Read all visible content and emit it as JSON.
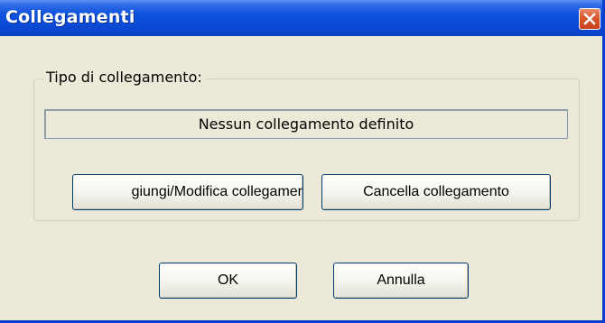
{
  "window": {
    "title": "Collegamenti"
  },
  "group": {
    "legend": "Tipo di collegamento:",
    "status_text": "Nessun collegamento definito",
    "add_button_label": "giungi/Modifica collegamer",
    "delete_button_label": "Cancella collegamento"
  },
  "footer": {
    "ok_label": "OK",
    "cancel_label": "Annulla"
  },
  "icons": {
    "close": "close-icon"
  },
  "colors": {
    "titlebar": "#0a49d4",
    "close_button": "#d9562d",
    "dialog_background": "#ece9d8"
  }
}
